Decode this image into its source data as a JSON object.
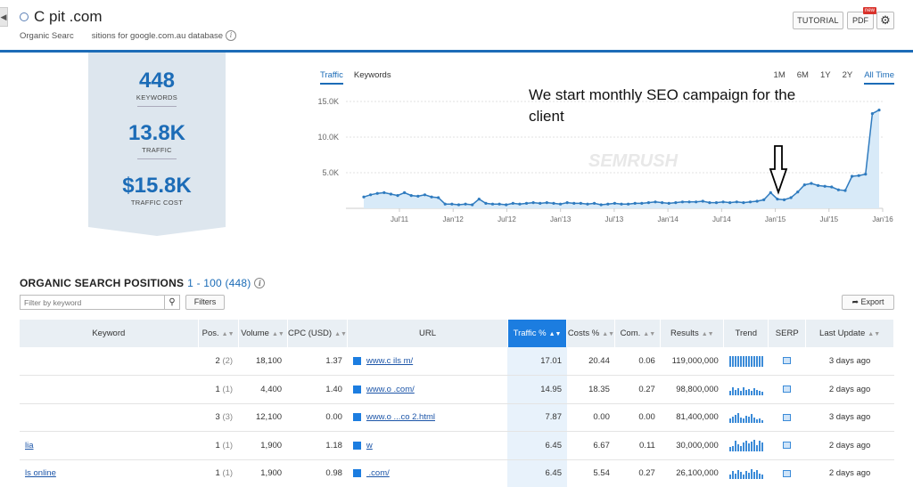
{
  "header": {
    "title": "C  pit    .com",
    "subtitle_left": "Organic Searc",
    "subtitle_right": "sitions for google.com.au database",
    "tutorial_label": "TUTORIAL",
    "pdf_label": "PDF",
    "new_badge": "new"
  },
  "stats": [
    {
      "value": "448",
      "label": "KEYWORDS"
    },
    {
      "value": "13.8K",
      "label": "TRAFFIC"
    },
    {
      "value": "$15.8K",
      "label": "TRAFFIC COST"
    }
  ],
  "chart_tabs": [
    "Traffic",
    "Keywords"
  ],
  "time_ranges": [
    "1M",
    "6M",
    "1Y",
    "2Y",
    "All Time"
  ],
  "annotation": "We start monthly SEO campaign for the client",
  "chart_data": {
    "type": "area",
    "title": "",
    "y_ticks": [
      "15.0K",
      "10.0K",
      "5.0K"
    ],
    "x_ticks": [
      "Jul'11",
      "Jan'12",
      "Jul'12",
      "Jan'13",
      "Jul'13",
      "Jan'14",
      "Jul'14",
      "Jan'15",
      "Jul'15",
      "Jan'16"
    ],
    "ylim": [
      0,
      15000
    ],
    "watermark": "SEMRUSH",
    "values": [
      1600,
      1900,
      2100,
      2200,
      2000,
      1800,
      2200,
      1800,
      1700,
      1900,
      1600,
      1500,
      600,
      600,
      500,
      600,
      500,
      1300,
      700,
      600,
      600,
      500,
      700,
      600,
      700,
      800,
      700,
      800,
      700,
      600,
      800,
      700,
      700,
      600,
      700,
      500,
      600,
      700,
      600,
      600,
      700,
      700,
      800,
      900,
      800,
      700,
      800,
      900,
      900,
      900,
      1000,
      800,
      800,
      900,
      800,
      900,
      800,
      900,
      1000,
      1200,
      2200,
      1300,
      1200,
      1500,
      2300,
      3300,
      3500,
      3200,
      3100,
      3000,
      2600,
      2500,
      4500,
      4600,
      4800,
      13300,
      13800
    ]
  },
  "table": {
    "title": "ORGANIC SEARCH POSITIONS",
    "range": "1 - 100 (448)",
    "filter_placeholder": "Filter by keyword",
    "filters_label": "Filters",
    "export_label": "Export",
    "columns": [
      "Keyword",
      "Pos.",
      "Volume",
      "CPC (USD)",
      "URL",
      "Traffic %",
      "Costs %",
      "Com.",
      "Results",
      "Trend",
      "SERP",
      "Last Update"
    ],
    "rows": [
      {
        "keyword": "  ",
        "pos": "2",
        "prev": "(2)",
        "volume": "18,100",
        "cpc": "1.37",
        "url": "www.c    ils    m/",
        "traffic": "17.01",
        "costs": "20.44",
        "com": "0.06",
        "results": "119,000,000",
        "update": "3 days ago"
      },
      {
        "keyword": "    ",
        "pos": "1",
        "prev": "(1)",
        "volume": "4,400",
        "cpc": "1.40",
        "url": "www.o     .com/",
        "traffic": "14.95",
        "costs": "18.35",
        "com": "0.27",
        "results": "98,800,000",
        "update": "2 days ago"
      },
      {
        "keyword": "  ",
        "pos": "3",
        "prev": "(3)",
        "volume": "12,100",
        "cpc": "0.00",
        "url": "www.o     ...co     2.html",
        "traffic": "7.87",
        "costs": "0.00",
        "com": "0.00",
        "results": "81,400,000",
        "update": "3 days ago"
      },
      {
        "keyword": "     lia",
        "pos": "1",
        "prev": "(1)",
        "volume": "1,900",
        "cpc": "1.18",
        "url": "w     ",
        "traffic": "6.45",
        "costs": "6.67",
        "com": "0.11",
        "results": "30,000,000",
        "update": "2 days ago"
      },
      {
        "keyword": "  ls online",
        "pos": "1",
        "prev": "(1)",
        "volume": "1,900",
        "cpc": "0.98",
        "url": "     .com/",
        "traffic": "6.45",
        "costs": "5.54",
        "com": "0.27",
        "results": "26,100,000",
        "update": "2 days ago"
      }
    ]
  },
  "colors": {
    "accent": "#1c6cb7",
    "traffic_header": "#1c7de0",
    "stats_bg": "#dde6ee"
  }
}
